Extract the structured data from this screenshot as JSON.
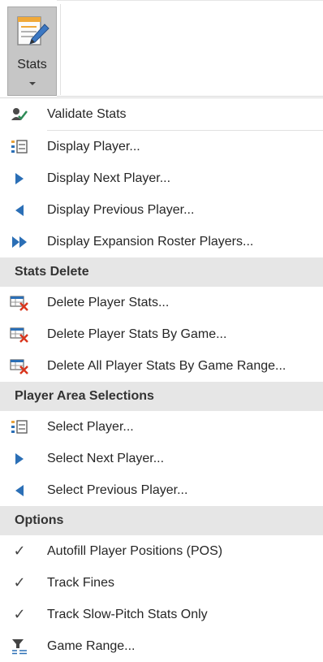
{
  "ribbon": {
    "stats_label": "Stats"
  },
  "menu": {
    "validate": "Validate Stats",
    "top_items": [
      "Display Player...",
      "Display Next Player...",
      "Display Previous Player...",
      "Display Expansion Roster Players..."
    ],
    "stats_delete": {
      "header": "Stats Delete",
      "items": [
        "Delete Player Stats...",
        "Delete Player Stats By Game...",
        "Delete All Player Stats By Game Range..."
      ]
    },
    "player_area": {
      "header": "Player Area Selections",
      "items": [
        "Select Player...",
        "Select Next Player...",
        "Select Previous Player..."
      ]
    },
    "options": {
      "header": "Options",
      "items": [
        "Autofill Player Positions (POS)",
        "Track Fines",
        "Track Slow-Pitch Stats Only",
        "Game Range..."
      ]
    }
  },
  "colors": {
    "accent_blue": "#2b6fb6",
    "delete_red": "#d9361d",
    "header_bg": "#e6e6e6",
    "selected_button_bg": "#c6c6c6"
  }
}
